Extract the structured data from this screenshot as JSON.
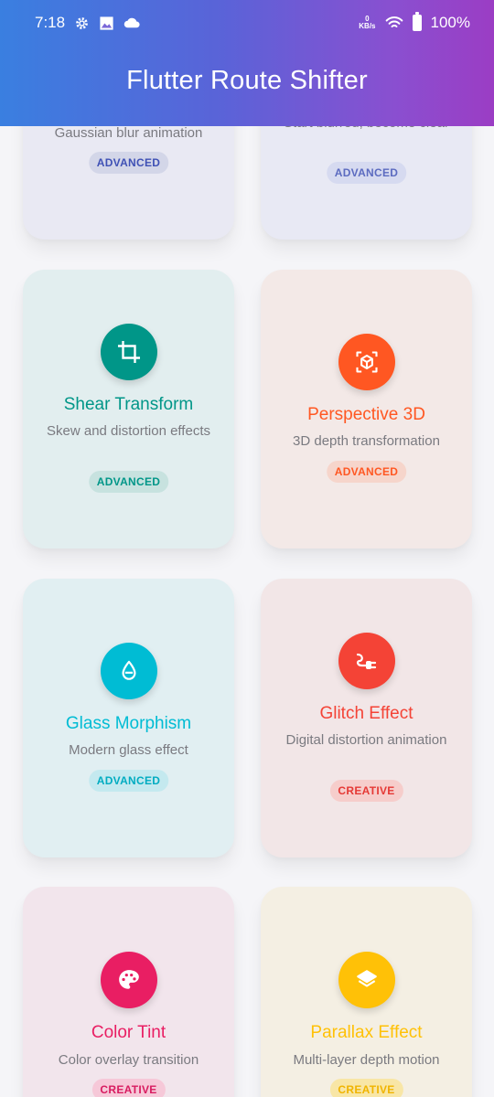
{
  "status_bar": {
    "time": "7:18",
    "net_speed_value": "0",
    "net_speed_unit": "KB/s",
    "battery": "100%",
    "icons": [
      "gear-icon",
      "image-icon",
      "cloud-icon",
      "wifi-icon",
      "battery-icon"
    ]
  },
  "app_bar": {
    "title": "Flutter Route Shifter"
  },
  "cards": [
    {
      "name": "",
      "desc": "Gaussian blur animation",
      "badge": "ADVANCED",
      "icon": "",
      "color": "#3f51b5"
    },
    {
      "name": "",
      "desc": "Start blurred, become clear",
      "badge": "ADVANCED",
      "icon": "",
      "color": "#5c6bc0"
    },
    {
      "name": "Shear Transform",
      "desc": "Skew and distortion effects",
      "badge": "ADVANCED",
      "icon": "crop-icon",
      "color": "#009688"
    },
    {
      "name": "Perspective 3D",
      "desc": "3D depth transformation",
      "badge": "ADVANCED",
      "icon": "3d-cube-icon",
      "color": "#ff5722"
    },
    {
      "name": "Glass Morphism",
      "desc": "Modern glass effect",
      "badge": "ADVANCED",
      "icon": "water-drop-icon",
      "color": "#00bcd4"
    },
    {
      "name": "Glitch Effect",
      "desc": "Digital distortion animation",
      "badge": "CREATIVE",
      "icon": "electrical-plug-icon",
      "color": "#f44336"
    },
    {
      "name": "Color Tint",
      "desc": "Color overlay transition",
      "badge": "CREATIVE",
      "icon": "palette-icon",
      "color": "#e91e63"
    },
    {
      "name": "Parallax Effect",
      "desc": "Multi-layer depth motion",
      "badge": "CREATIVE",
      "icon": "layers-icon",
      "color": "#ffc107"
    }
  ]
}
